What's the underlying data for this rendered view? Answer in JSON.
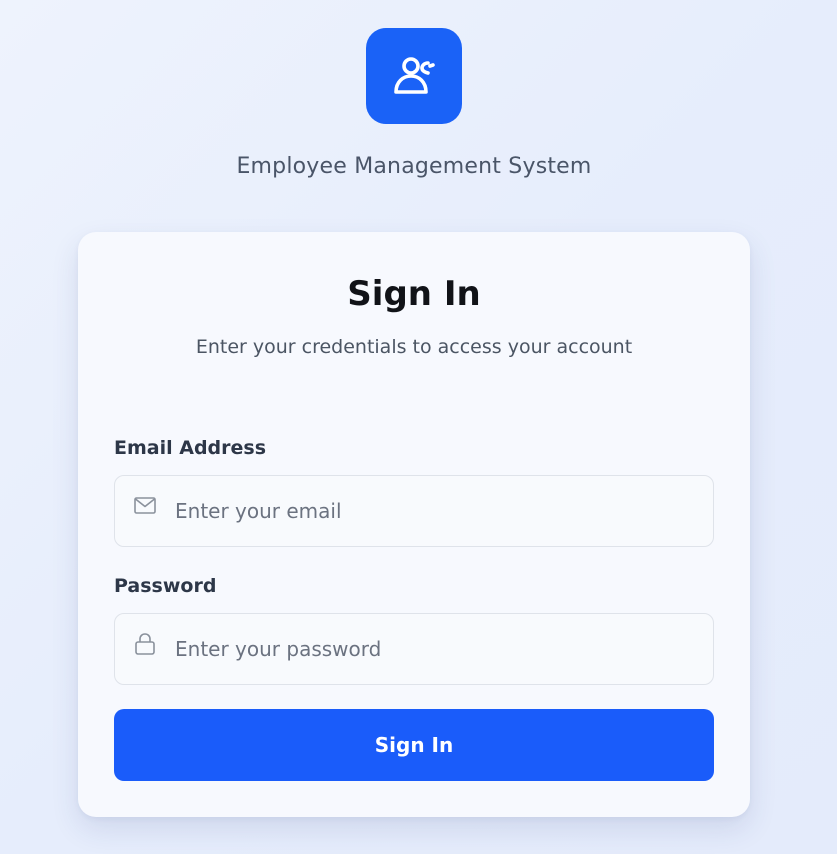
{
  "brand": {
    "app_name": "Employee Management System",
    "logo_icon": "users-icon",
    "accent_color": "#1a62f7"
  },
  "card": {
    "title": "Sign In",
    "subtitle": "Enter your credentials to access your account"
  },
  "form": {
    "email": {
      "label": "Email Address",
      "placeholder": "Enter your email",
      "value": "",
      "icon": "mail-icon"
    },
    "password": {
      "label": "Password",
      "placeholder": "Enter your password",
      "value": "",
      "icon": "lock-icon"
    },
    "submit_label": "Sign In",
    "button_color": "#1a5cfa"
  }
}
